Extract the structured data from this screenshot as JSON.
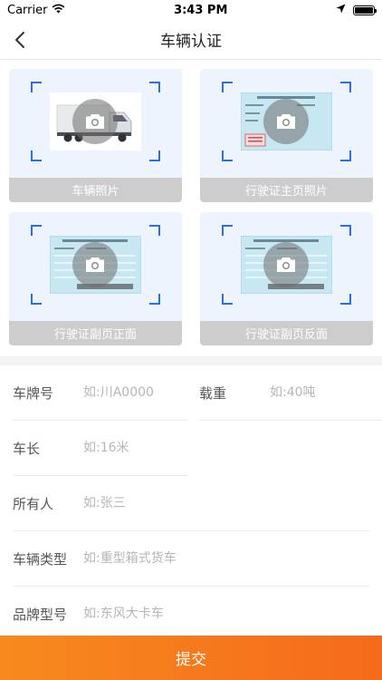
{
  "status_bar": {
    "carrier": "Carrier",
    "time": "3:43 PM"
  },
  "nav": {
    "title": "车辆认证"
  },
  "photos": [
    {
      "caption": "车辆照片"
    },
    {
      "caption": "行驶证主页照片"
    },
    {
      "caption": "行驶证副页正面"
    },
    {
      "caption": "行驶证副页反面"
    }
  ],
  "form": {
    "plate": {
      "label": "车牌号",
      "placeholder": "如:川A0000"
    },
    "load": {
      "label": "载重",
      "placeholder": "如:40吨"
    },
    "length": {
      "label": "车长",
      "placeholder": "如:16米"
    },
    "owner": {
      "label": "所有人",
      "placeholder": "如:张三"
    },
    "type": {
      "label": "车辆类型",
      "placeholder": "如:重型箱式货车"
    },
    "brand": {
      "label": "品牌型号",
      "placeholder": "如:东风大卡车"
    }
  },
  "submit": {
    "label": "提交"
  },
  "colors": {
    "accent": "#f56a1b",
    "bracket": "#2b6fdc",
    "caption_bg": "#cdcdcd",
    "card_bg": "#eef4fe"
  }
}
